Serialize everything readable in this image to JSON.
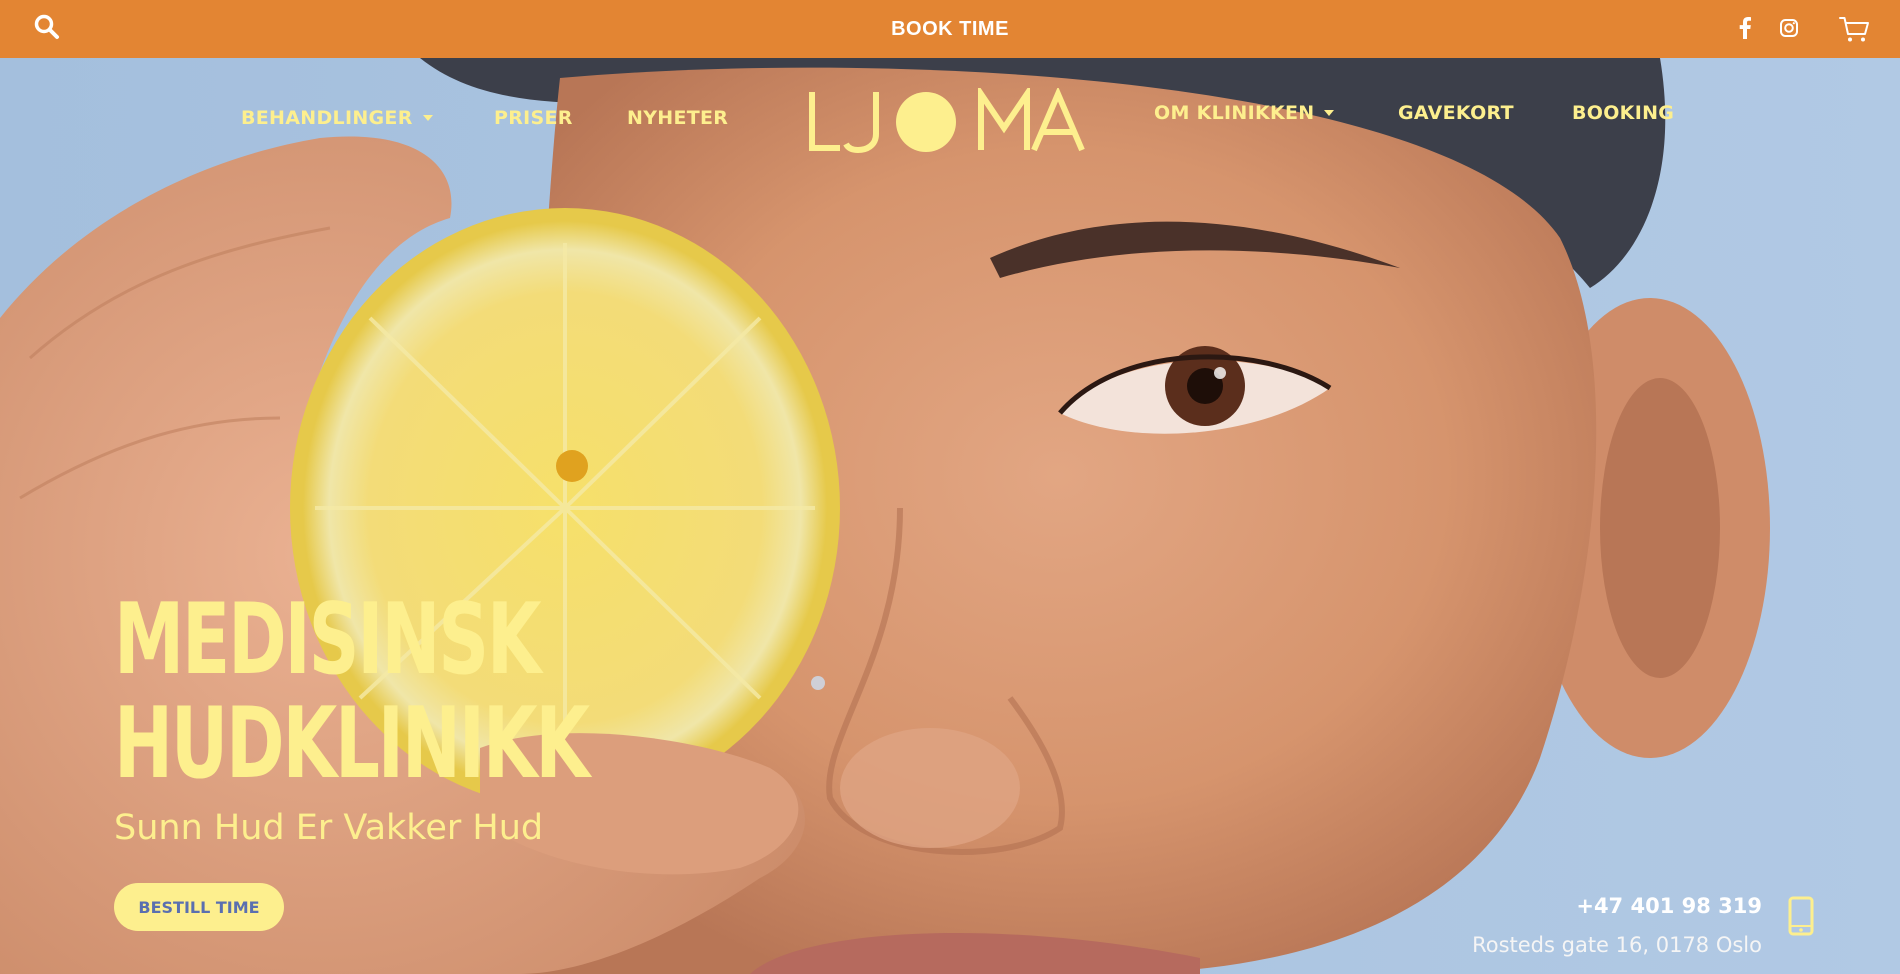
{
  "topbar": {
    "book_label": "BOOK TIME",
    "icons": [
      "search-icon",
      "facebook-icon",
      "instagram-icon",
      "cart-icon"
    ],
    "bg_color": "#e38533"
  },
  "nav": {
    "left": [
      {
        "label": "BEHANDLINGER",
        "has_dropdown": true
      },
      {
        "label": "PRISER",
        "has_dropdown": false
      },
      {
        "label": "NYHETER",
        "has_dropdown": false
      }
    ],
    "right": [
      {
        "label": "OM KLINIKKEN",
        "has_dropdown": true
      },
      {
        "label": "GAVEKORT",
        "has_dropdown": false
      },
      {
        "label": "BOOKING",
        "has_dropdown": false
      }
    ],
    "logo_text": "LJOMA",
    "accent_color": "#fdef8e"
  },
  "hero": {
    "headline_line1": "MEDISINSK",
    "headline_line2": "HUDKLINIKK",
    "subheadline": "Sunn Hud Er Vakker Hud",
    "cta_label": "BESTILL TIME",
    "cta_text_color": "#5a6fb0"
  },
  "contact": {
    "phone": "+47 401 98 319",
    "address": "Rosteds gate 16, 0178 Oslo"
  }
}
